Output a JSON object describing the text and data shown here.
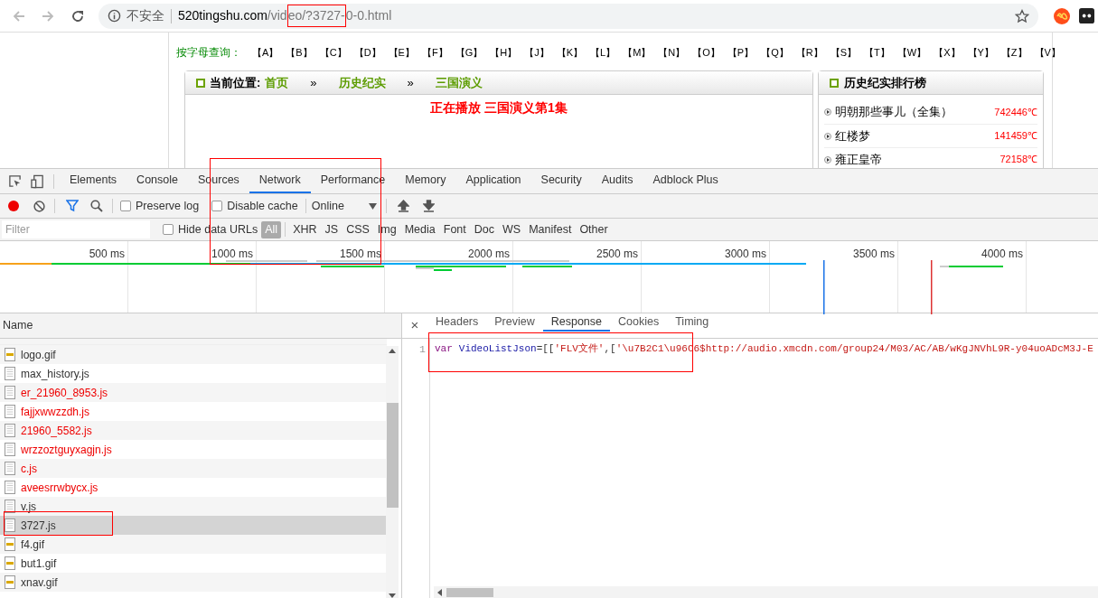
{
  "browser": {
    "security": "不安全",
    "url_parts": [
      {
        "kind": "host",
        "text": "520tingshu.com"
      },
      {
        "kind": "path",
        "text": "/vid"
      },
      {
        "kind": "marked",
        "text": "eo/?3727-"
      },
      {
        "kind": "path",
        "text": "0-0.html"
      }
    ]
  },
  "page": {
    "letter_label": "按字母查询：",
    "letters": [
      "【A】",
      "【B】",
      "【C】",
      "【D】",
      "【E】",
      "【F】",
      "【G】",
      "【H】",
      "【J】",
      "【K】",
      "【L】",
      "【M】",
      "【N】",
      "【O】",
      "【P】",
      "【Q】",
      "【R】",
      "【S】",
      "【T】",
      "【W】",
      "【X】",
      "【Y】",
      "【Z】",
      "【V】"
    ],
    "breadcrumb": {
      "label": "当前位置:",
      "items": [
        "首页",
        "历史纪实",
        "三国演义"
      ],
      "separator": "»"
    },
    "now_playing": "正在播放 三国演义第1集",
    "ranking": {
      "title": "历史纪实排行榜",
      "items": [
        {
          "name": "明朝那些事儿（全集）",
          "count": "742446℃"
        },
        {
          "name": "红楼梦",
          "count": "141459℃"
        },
        {
          "name": "雍正皇帝",
          "count": "72158℃"
        }
      ]
    }
  },
  "devtools": {
    "tabs": [
      {
        "label": "Elements",
        "selected": false
      },
      {
        "label": "Console",
        "selected": false
      },
      {
        "label": "Sources",
        "selected": false
      },
      {
        "label": "Network",
        "selected": true
      },
      {
        "label": "Performance",
        "selected": false
      },
      {
        "label": "Memory",
        "selected": false
      },
      {
        "label": "Application",
        "selected": false
      },
      {
        "label": "Security",
        "selected": false
      },
      {
        "label": "Audits",
        "selected": false
      },
      {
        "label": "Adblock Plus",
        "selected": false
      }
    ],
    "toolbar": {
      "recording": true,
      "preserve_log": {
        "label": "Preserve log",
        "checked": false
      },
      "disable_cache": {
        "label": "Disable cache",
        "checked": false
      },
      "throttle": "Online"
    },
    "filter": {
      "placeholder": "Filter",
      "hide_data_urls": {
        "label": "Hide data URLs",
        "checked": false
      },
      "types": [
        {
          "label": "All",
          "selected": true
        },
        {
          "label": "XHR",
          "selected": false
        },
        {
          "label": "JS",
          "selected": false
        },
        {
          "label": "CSS",
          "selected": false
        },
        {
          "label": "Img",
          "selected": false
        },
        {
          "label": "Media",
          "selected": false
        },
        {
          "label": "Font",
          "selected": false
        },
        {
          "label": "Doc",
          "selected": false
        },
        {
          "label": "WS",
          "selected": false
        },
        {
          "label": "Manifest",
          "selected": false
        },
        {
          "label": "Other",
          "selected": false
        }
      ]
    },
    "timeline_ticks": [
      "500 ms",
      "1000 ms",
      "1500 ms",
      "2000 ms",
      "2500 ms",
      "3000 ms",
      "3500 ms",
      "4000 ms"
    ],
    "name_column": "Name",
    "requests": [
      {
        "name": "logo.gif",
        "kind": "image",
        "failed": false,
        "selected": false
      },
      {
        "name": "max_history.js",
        "kind": "script",
        "failed": false,
        "selected": false
      },
      {
        "name": "er_21960_8953.js",
        "kind": "script",
        "failed": true,
        "selected": false
      },
      {
        "name": "fajjxwwzzdh.js",
        "kind": "script",
        "failed": true,
        "selected": false
      },
      {
        "name": "21960_5582.js",
        "kind": "script",
        "failed": true,
        "selected": false
      },
      {
        "name": "wrzzoztguyxagjn.js",
        "kind": "script",
        "failed": true,
        "selected": false
      },
      {
        "name": "c.js",
        "kind": "script",
        "failed": true,
        "selected": false
      },
      {
        "name": "aveesrrwbycx.js",
        "kind": "script",
        "failed": true,
        "selected": false
      },
      {
        "name": "v.js",
        "kind": "script",
        "failed": false,
        "selected": false
      },
      {
        "name": "3727.js",
        "kind": "script",
        "failed": false,
        "selected": true
      },
      {
        "name": "f4.gif",
        "kind": "image",
        "failed": false,
        "selected": false
      },
      {
        "name": "but1.gif",
        "kind": "image",
        "failed": false,
        "selected": false
      },
      {
        "name": "xnav.gif",
        "kind": "image",
        "failed": false,
        "selected": false
      }
    ],
    "detail_close": "×",
    "detail_tabs": [
      {
        "label": "Headers",
        "selected": false
      },
      {
        "label": "Preview",
        "selected": false
      },
      {
        "label": "Response",
        "selected": true
      },
      {
        "label": "Cookies",
        "selected": false
      },
      {
        "label": "Timing",
        "selected": false
      }
    ],
    "response_lines": [
      {
        "number": "1",
        "tokens": [
          {
            "kind": "keyword",
            "text": "var"
          },
          {
            "kind": "variable",
            "text": "VideoListJson"
          },
          {
            "kind": "punct",
            "text": "=[["
          },
          {
            "kind": "string",
            "text": "'FLV文件'"
          },
          {
            "kind": "punct",
            "text": ",["
          },
          {
            "kind": "string",
            "text": "'\\u7B2C1\\u96C6$http://audio.xmcdn.com/group24/M03/AC/AB/wKgJNVhL9R-y04uoADcM3J-E"
          }
        ]
      }
    ]
  }
}
